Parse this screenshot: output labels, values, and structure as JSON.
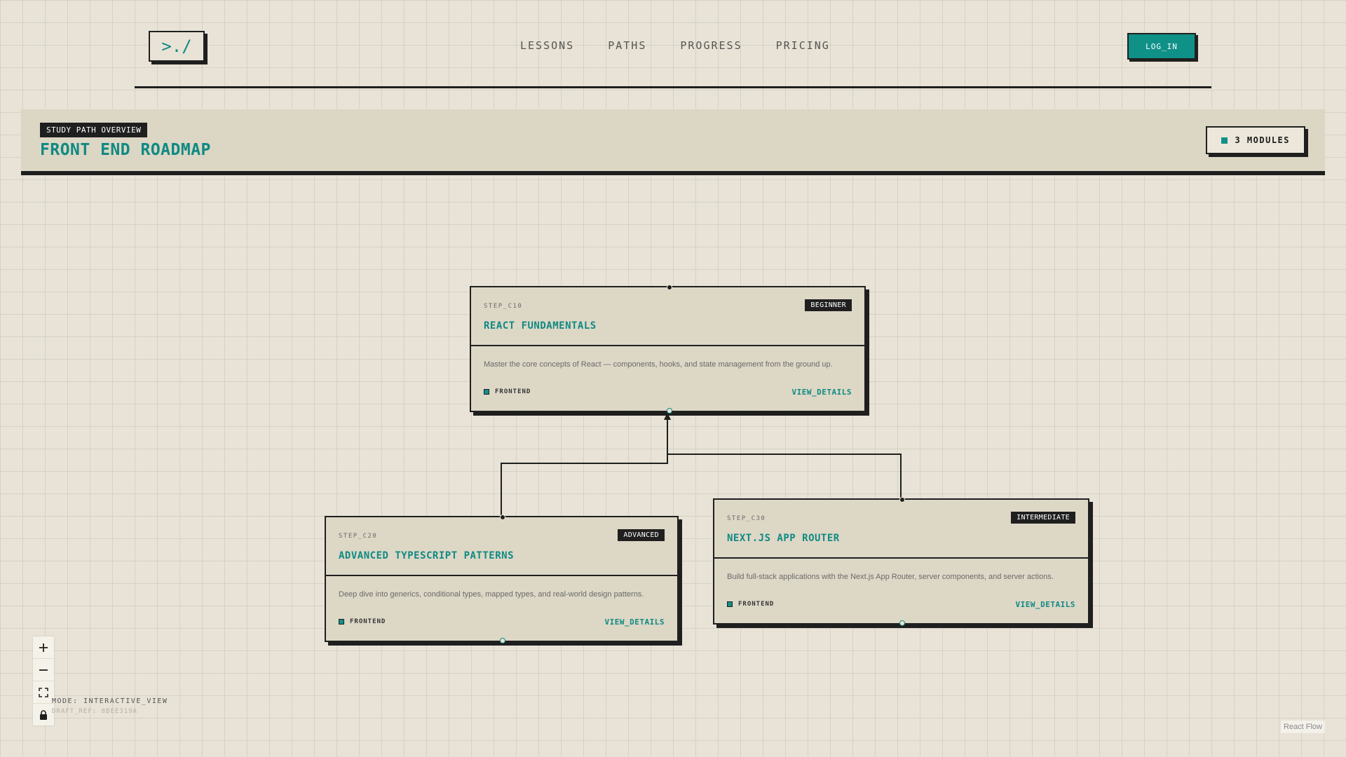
{
  "app": {
    "logo": ">./",
    "nav": [
      "LESSONS",
      "PATHS",
      "PROGRESS",
      "PRICING"
    ],
    "login": "LOG_IN"
  },
  "header": {
    "label": "STUDY PATH OVERVIEW",
    "title": "FRONT END ROADMAP",
    "modules": "3 MODULES"
  },
  "nodes": [
    {
      "id": "STEP_C10",
      "level": "BEGINNER",
      "title": "REACT FUNDAMENTALS",
      "desc": "Master the core concepts of React — components, hooks, and state management from the ground up.",
      "tag": "FRONTEND",
      "cta": "VIEW_DETAILS"
    },
    {
      "id": "STEP_C20",
      "level": "ADVANCED",
      "title": "ADVANCED TYPESCRIPT PATTERNS",
      "desc": "Deep dive into generics, conditional types, mapped types, and real-world design patterns.",
      "tag": "FRONTEND",
      "cta": "VIEW_DETAILS"
    },
    {
      "id": "STEP_C30",
      "level": "INTERMEDIATE",
      "title": "NEXT.JS APP ROUTER",
      "desc": "Build full-stack applications with the Next.js App Router, server components, and server actions.",
      "tag": "FRONTEND",
      "cta": "VIEW_DETAILS"
    }
  ],
  "footer": {
    "mode": "MODE: INTERACTIVE_VIEW",
    "draft": "DRAFT_REF: 8BEE319A",
    "attribution": "React Flow"
  },
  "icons": {
    "zoom_in": "plus-icon",
    "zoom_out": "minus-icon",
    "fit": "fit-view-icon",
    "lock": "lock-icon"
  },
  "colors": {
    "accent": "#0f9188",
    "ink": "#1f1f1f",
    "paper": "#e8e3d6",
    "card": "#ddd7c6"
  }
}
